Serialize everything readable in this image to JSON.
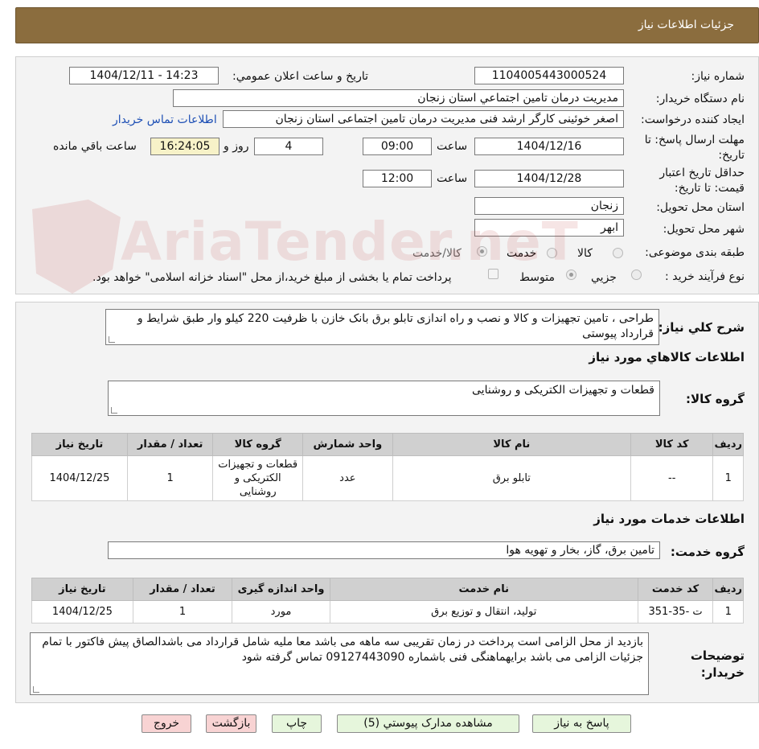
{
  "header": {
    "title": "جزئيات اطلاعات نياز"
  },
  "labels": {
    "need_number": "شماره نياز:",
    "announce_datetime": "تاريخ و ساعت اعلان عمومي:",
    "buyer_org": "نام دستگاه خريدار:",
    "requester": "ايجاد کننده درخواست:",
    "buyer_contact_link": "اطلاعات تماس خريدار",
    "reply_deadline": "مهلت ارسال پاسخ: تا تاريخ:",
    "time_word": "ساعت",
    "days_word": "روز و",
    "remaining_word": "ساعت باقي مانده",
    "price_validity": "حداقل تاريخ اعتبار قيمت: تا تاريخ:",
    "delivery_province": "استان محل تحويل:",
    "delivery_city": "شهر محل تحويل:",
    "category": "طبقه بندی موضوعی:",
    "purchase_type": "نوع فرآيند خريد :",
    "cat_goods": "کالا",
    "cat_service": "خدمت",
    "cat_goods_service": "کالا/خدمت",
    "ptype_partial": "جزيي",
    "ptype_medium": "متوسط",
    "payment_note": "پرداخت تمام يا بخشی از مبلغ خريد،از محل \"اسناد خزانه اسلامی\" خواهد بود."
  },
  "fields": {
    "need_number": "1104005443000524",
    "announce_datetime": "1404/12/11 - 14:23",
    "buyer_org": "مديريت درمان تامين اجتماعي استان زنجان",
    "requester": "اصغر خوئینی کارگر ارشد فنی مدیریت درمان تامین اجتماعی استان زنجان",
    "reply_date": "1404/12/16",
    "reply_time": "09:00",
    "days_left": "4",
    "time_left": "16:24:05",
    "validity_date": "1404/12/28",
    "validity_time": "12:00",
    "province": "زنجان",
    "city": "ابهر"
  },
  "summary": {
    "label": "شرح کلي نياز:",
    "text": "طراحی ، تامین تجهیزات و کالا  و نصب و راه اندازی تابلو برق بانک خازن با ظرفیت 220 کیلو وار طبق شرایط و قرارداد پیوستی"
  },
  "goods": {
    "title": "اطلاعات کالاهاي مورد نياز",
    "group_label": "گروه کالا:",
    "group_value": "قطعات و تجهیزات الکتریکی و روشنایی",
    "columns": [
      "رديف",
      "کد کالا",
      "نام کالا",
      "واحد شمارش",
      "گروه کالا",
      "تعداد / مقدار",
      "تاريخ نياز"
    ],
    "rows": [
      [
        "1",
        "--",
        "تابلو برق",
        "عدد",
        "قطعات و تجهیزات الکتریکی و روشنایی",
        "1",
        "1404/12/25"
      ]
    ]
  },
  "services": {
    "title": "اطلاعات خدمات مورد نياز",
    "group_label": "گروه خدمت:",
    "group_value": "تامین برق، گاز، بخار و تهویه هوا",
    "columns": [
      "رديف",
      "کد خدمت",
      "نام خدمت",
      "واحد اندازه گيری",
      "تعداد / مقدار",
      "تاريخ نياز"
    ],
    "rows": [
      [
        "1",
        "ت -35-351",
        "تولید، انتقال و توزیع برق",
        "مورد",
        "1",
        "1404/12/25"
      ]
    ]
  },
  "buyer_notes": {
    "label": "توضيحات خريدار:",
    "text": "بازدید از محل الزامی است پرداخت در زمان تقریبی سه ماهه می باشد معا ملیه شامل قرارداد می باشدالصاق پیش فاکتور با تمام جزئیات الزامی می باشد برایهماهنگی فنی باشماره 09127443090 تماس گرفته شود"
  },
  "buttons": {
    "reply": "پاسخ به نياز",
    "attachments": "مشاهده مدارک پيوستي (5)",
    "print": "چاپ",
    "back": "بازگشت",
    "exit": "خروج"
  },
  "watermark_text": "AriaTender.neT",
  "colors": {
    "header_bg": "#8b6d3e",
    "panel_bg": "#f3f3f3",
    "link": "#1d4fb5",
    "btn_green": "#e6f6dc",
    "btn_red": "#f8d3d3",
    "time_left_bg": "#f7f2c8"
  }
}
